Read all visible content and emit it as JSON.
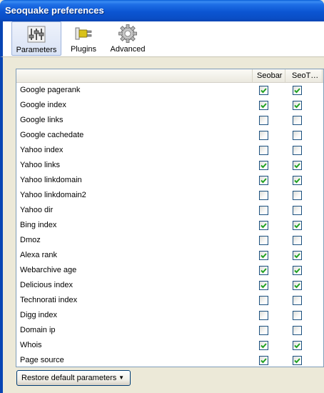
{
  "window": {
    "title": "Seoquake preferences"
  },
  "toolbar": {
    "items": [
      {
        "label": "Parameters",
        "icon": "sliders-icon",
        "selected": true
      },
      {
        "label": "Plugins",
        "icon": "plug-icon",
        "selected": false
      },
      {
        "label": "Advanced",
        "icon": "gear-icon",
        "selected": false
      }
    ]
  },
  "table": {
    "columns": [
      "",
      "Seobar",
      "SeoT…"
    ],
    "rows": [
      {
        "name": "Google pagerank",
        "seobar": true,
        "seotoolbar": true
      },
      {
        "name": "Google index",
        "seobar": true,
        "seotoolbar": true
      },
      {
        "name": "Google links",
        "seobar": false,
        "seotoolbar": false
      },
      {
        "name": "Google cachedate",
        "seobar": false,
        "seotoolbar": false
      },
      {
        "name": "Yahoo index",
        "seobar": false,
        "seotoolbar": false
      },
      {
        "name": "Yahoo links",
        "seobar": true,
        "seotoolbar": true
      },
      {
        "name": "Yahoo linkdomain",
        "seobar": true,
        "seotoolbar": true
      },
      {
        "name": "Yahoo linkdomain2",
        "seobar": false,
        "seotoolbar": false
      },
      {
        "name": "Yahoo dir",
        "seobar": false,
        "seotoolbar": false
      },
      {
        "name": "Bing index",
        "seobar": true,
        "seotoolbar": true
      },
      {
        "name": "Dmoz",
        "seobar": false,
        "seotoolbar": false
      },
      {
        "name": "Alexa rank",
        "seobar": true,
        "seotoolbar": true
      },
      {
        "name": "Webarchive age",
        "seobar": true,
        "seotoolbar": true
      },
      {
        "name": "Delicious index",
        "seobar": true,
        "seotoolbar": true
      },
      {
        "name": "Technorati index",
        "seobar": false,
        "seotoolbar": false
      },
      {
        "name": "Digg index",
        "seobar": false,
        "seotoolbar": false
      },
      {
        "name": "Domain ip",
        "seobar": false,
        "seotoolbar": false
      },
      {
        "name": "Whois",
        "seobar": true,
        "seotoolbar": true
      },
      {
        "name": "Page source",
        "seobar": true,
        "seotoolbar": true
      }
    ]
  },
  "footer": {
    "restore_label": "Restore default parameters"
  },
  "colors": {
    "titlebar": "#0b55d2",
    "check": "#21a121",
    "checkbox_border": "#1c5180"
  }
}
